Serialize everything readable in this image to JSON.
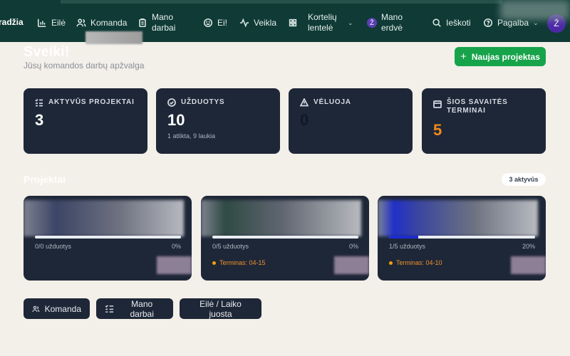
{
  "nav": {
    "brand": "radžia",
    "items": [
      {
        "label": "Eilė",
        "icon": "bar-chart-icon"
      },
      {
        "label": "Komanda",
        "icon": "users-icon"
      },
      {
        "label": "Mano darbai",
        "icon": "clipboard-icon"
      },
      {
        "label": "Ei!",
        "icon": "smile-icon"
      },
      {
        "label": "Veikla",
        "icon": "activity-icon"
      },
      {
        "label": "Kortelių lentelė",
        "icon": "grid-icon"
      },
      {
        "label": "Mano erdvė",
        "icon": "workspace-badge-icon",
        "badge": "Ž"
      },
      {
        "label": "Ieškoti",
        "icon": "search-icon"
      },
      {
        "label": "Pagalba",
        "icon": "help-circle-icon"
      }
    ],
    "avatar": "Ž"
  },
  "header": {
    "greeting": "Sveiki!",
    "subtitle": "Jūsų komandos darbų apžvalga",
    "new_project_label": "Naujas projektas"
  },
  "stats": [
    {
      "label": "AKTYVŪS PROJEKTAI",
      "value": "3",
      "sub": "",
      "icon": "list-check-icon",
      "color": "#ffffff"
    },
    {
      "label": "UŽDUOTYS",
      "value": "10",
      "sub": "1 atlikta, 9 laukia",
      "icon": "check-circle-icon",
      "color": "#ffffff"
    },
    {
      "label": "VĖLUOJA",
      "value": "0",
      "sub": "",
      "icon": "warning-icon",
      "color": "#111827"
    },
    {
      "label": "ŠIOS SAVAITĖS TERMINAI",
      "value": "5",
      "sub": "",
      "icon": "calendar-icon",
      "color": "#f08a1c"
    }
  ],
  "projects": {
    "title": "Projektai",
    "badge": "3 aktyvūs",
    "cards": [
      {
        "tasks": "0/0 užduotys",
        "percent": "0%",
        "progress": 0,
        "deadline": ""
      },
      {
        "tasks": "0/5 užduotys",
        "percent": "0%",
        "progress": 0,
        "deadline": "Terminas: 04-15"
      },
      {
        "tasks": "1/5 užduotys",
        "percent": "20%",
        "progress": 0.2,
        "deadline": "Terminas: 04-10"
      }
    ]
  },
  "quick_links": [
    {
      "label": "Komanda",
      "icon": "users-icon"
    },
    {
      "label": "Mano darbai",
      "icon": "list-check-icon"
    },
    {
      "label": "Eilė / Laiko juosta",
      "icon": ""
    }
  ]
}
